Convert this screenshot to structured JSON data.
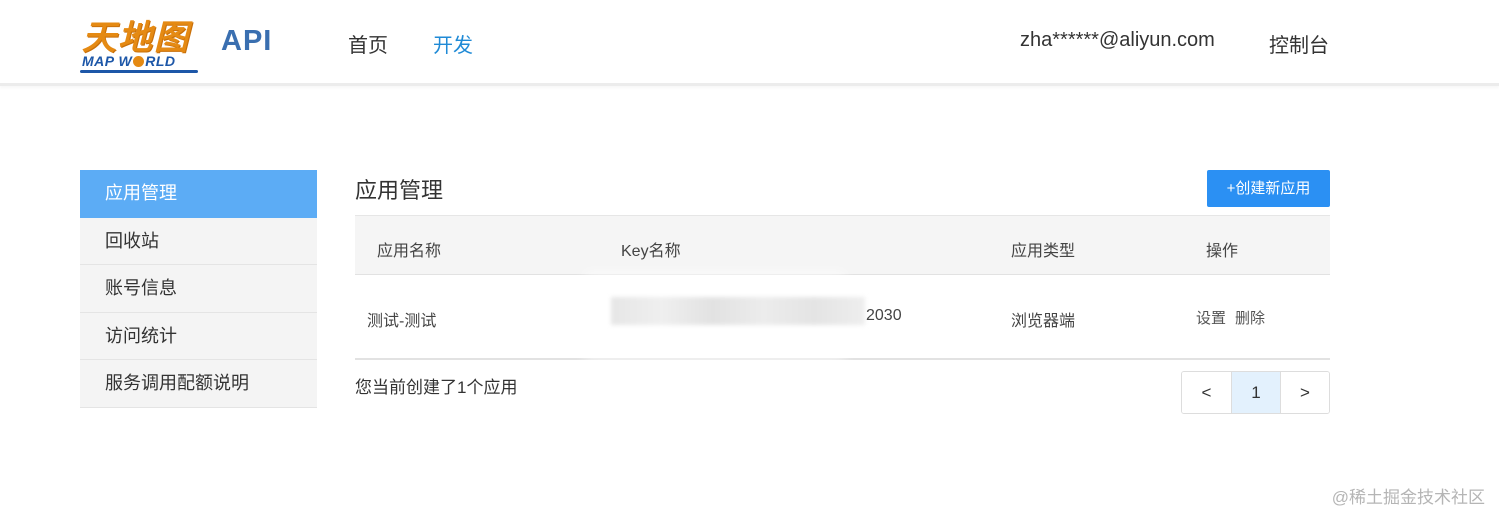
{
  "header": {
    "logo_cn": "天地图",
    "logo_en_left": "MAP W",
    "logo_en_right": "RLD",
    "api_label": "API",
    "nav": {
      "home": "首页",
      "dev": "开发"
    },
    "user_email": "zha******@aliyun.com",
    "console": "控制台"
  },
  "sidebar": {
    "items": [
      {
        "label": "应用管理",
        "active": true
      },
      {
        "label": "回收站"
      },
      {
        "label": "账号信息"
      },
      {
        "label": "访问统计"
      },
      {
        "label": "服务调用配额说明"
      }
    ]
  },
  "main": {
    "title": "应用管理",
    "create_button": "+创建新应用",
    "table": {
      "headers": [
        "应用名称",
        "Key名称",
        "应用类型",
        "操作"
      ],
      "rows": [
        {
          "name": "测试-测试",
          "key_visible": "2030",
          "type": "浏览器端",
          "actions": [
            "设置",
            "删除"
          ]
        }
      ]
    },
    "count_text": "您当前创建了1个应用",
    "pager": {
      "prev": "<",
      "current": "1",
      "next": ">"
    }
  },
  "watermark": "@稀土掘金技术社区",
  "colors": {
    "accent": "#2b90f3",
    "sidebar_active": "#5cacf5",
    "nav_active": "#1f8ad6",
    "logo_orange": "#e58a13",
    "logo_blue": "#1d57a8"
  }
}
